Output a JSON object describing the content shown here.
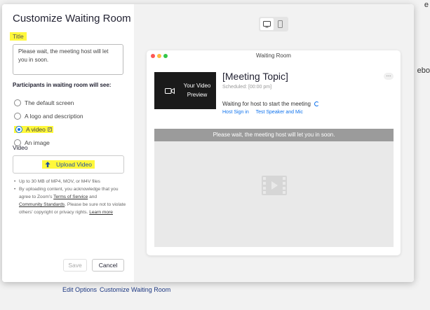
{
  "background": {
    "frag_top": "...",
    "frag_top_right": "e",
    "frag_right": "ebo",
    "footer_edit": "Edit Options",
    "footer_customize": "Customize Waiting Room"
  },
  "modal": {
    "title": "Customize Waiting Room",
    "title_label": "Title",
    "title_text": "Please wait, the meeting host will let you in soon.",
    "participants_label": "Participants in waiting room will see:",
    "options": [
      {
        "label": "The default screen",
        "checked": false
      },
      {
        "label": "A logo and description",
        "checked": false
      },
      {
        "label": "A video",
        "checked": true
      },
      {
        "label": "An image",
        "checked": false
      }
    ],
    "video_label": "Video",
    "upload_label": "Upload Video",
    "notes": {
      "n1": "Up to 30 MB of MP4, MOV, or M4V files",
      "n2_a": "By uploading content, you acknowledge that you agree to Zoom's ",
      "n2_link1": "Terms of Service",
      "n2_b": " and ",
      "n2_link2": "Community Standards",
      "n2_c": ". Please be sure not to violate others' copyright or privacy rights. ",
      "n2_link3": "Learn more"
    },
    "save_label": "Save",
    "cancel_label": "Cancel"
  },
  "preview": {
    "window_title": "Waiting Room",
    "video_preview": "Your Video Preview",
    "meeting_topic": "[Meeting Topic]",
    "scheduled": "Scheduled: [00:00 pm]",
    "waiting_text": "Waiting for host to start the meeting",
    "link_host": "Host Sign in",
    "link_test": "Test Speaker and Mic",
    "more": "...",
    "banner": "Please wait, the meeting host will let you in soon."
  },
  "colors": {
    "highlight": "#fff83b",
    "accent": "#0e72ed",
    "banner_bg": "#9b9b9b"
  },
  "icons": [
    "monitor-icon",
    "phone-icon",
    "camera-icon",
    "film-play-icon",
    "upload-arrow-icon",
    "spinner-icon"
  ]
}
